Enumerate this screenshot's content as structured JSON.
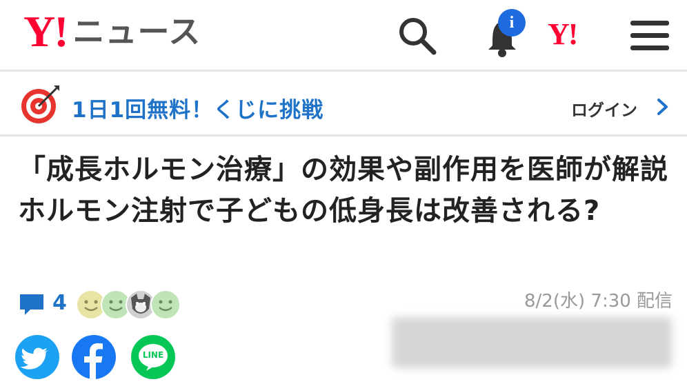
{
  "header": {
    "logo_mark": "Y!",
    "logo_text": "ニュース",
    "notification_badge": "i",
    "yahoo_mark": "Y!",
    "icons": [
      "search-icon",
      "bell-icon",
      "yahoo-logo",
      "menu-icon"
    ]
  },
  "promo": {
    "text": "1日1回無料！くじに挑戦",
    "login_label": "ログイン"
  },
  "article": {
    "title": "「成長ホルモン治療」の効果や副作用を医師が解説 ホルモン注射で子どもの低身長は改善される?",
    "comment_count": "4",
    "date": "8/2(水) 7:30 配信"
  },
  "share": {
    "icons": [
      "twitter-icon",
      "facebook-icon",
      "line-icon"
    ],
    "line_label": "LINE"
  },
  "colors": {
    "brand_red": "#ff0033",
    "link_blue": "#1e73c8",
    "badge_blue": "#1e6be0",
    "twitter": "#1da1f2",
    "facebook": "#1877f2",
    "line": "#06c755"
  }
}
